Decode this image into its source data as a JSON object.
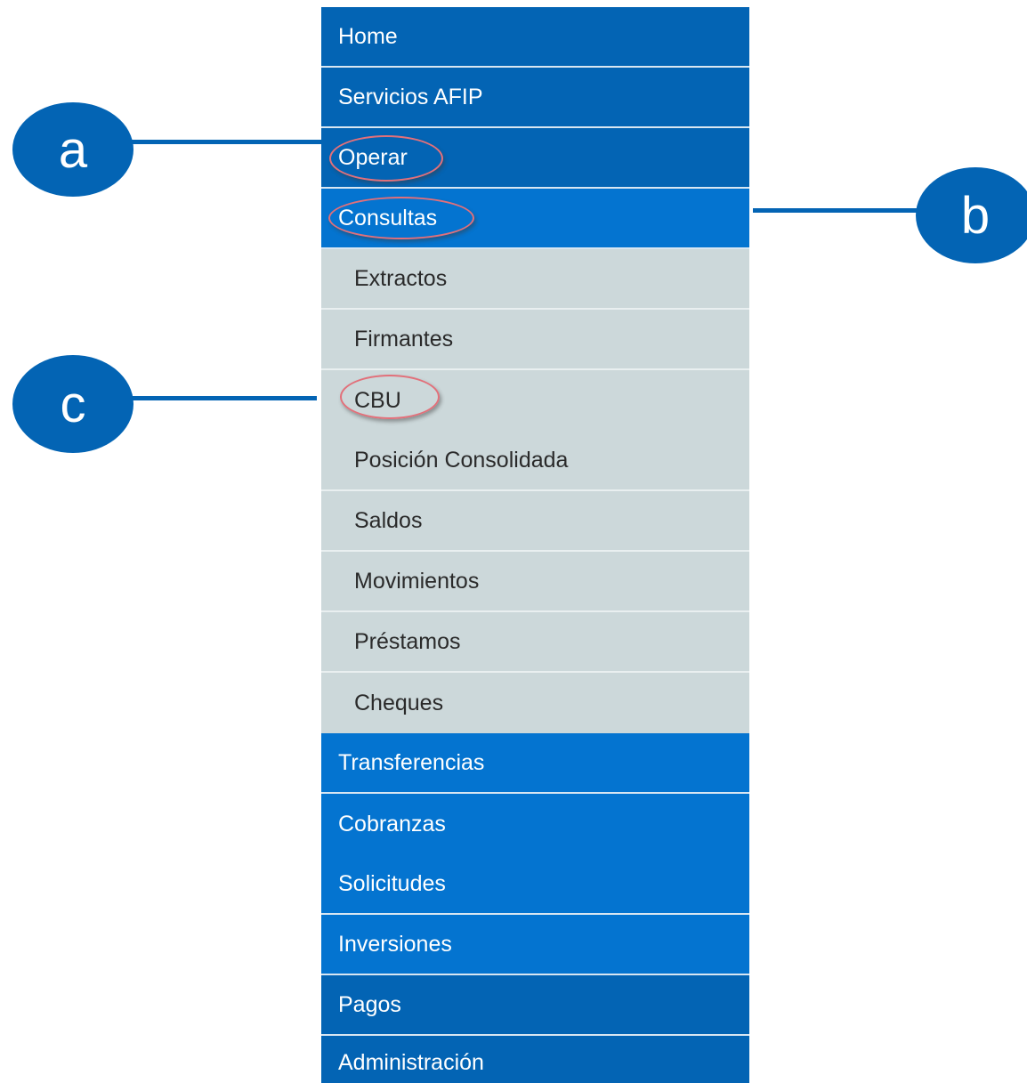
{
  "menu": {
    "home": "Home",
    "servicios_afip": "Servicios AFIP",
    "operar": "Operar",
    "consultas": "Consultas",
    "consultas_sub": {
      "extractos": "Extractos",
      "firmantes": "Firmantes",
      "cbu": "CBU",
      "posicion_consolidada": "Posición Consolidada",
      "saldos": "Saldos",
      "movimientos": "Movimientos",
      "prestamos": "Préstamos",
      "cheques": "Cheques"
    },
    "transferencias": "Transferencias",
    "cobranzas": "Cobranzas",
    "solicitudes": "Solicitudes",
    "inversiones": "Inversiones",
    "pagos": "Pagos",
    "administracion": "Administración"
  },
  "callouts": {
    "a": "a",
    "b": "b",
    "c": "c"
  },
  "colors": {
    "menu_dark": "#0364b4",
    "menu_bright": "#0474d0",
    "submenu_bg": "#ccd8da",
    "highlight_ring": "#e2707a",
    "callout": "#0364b4"
  }
}
